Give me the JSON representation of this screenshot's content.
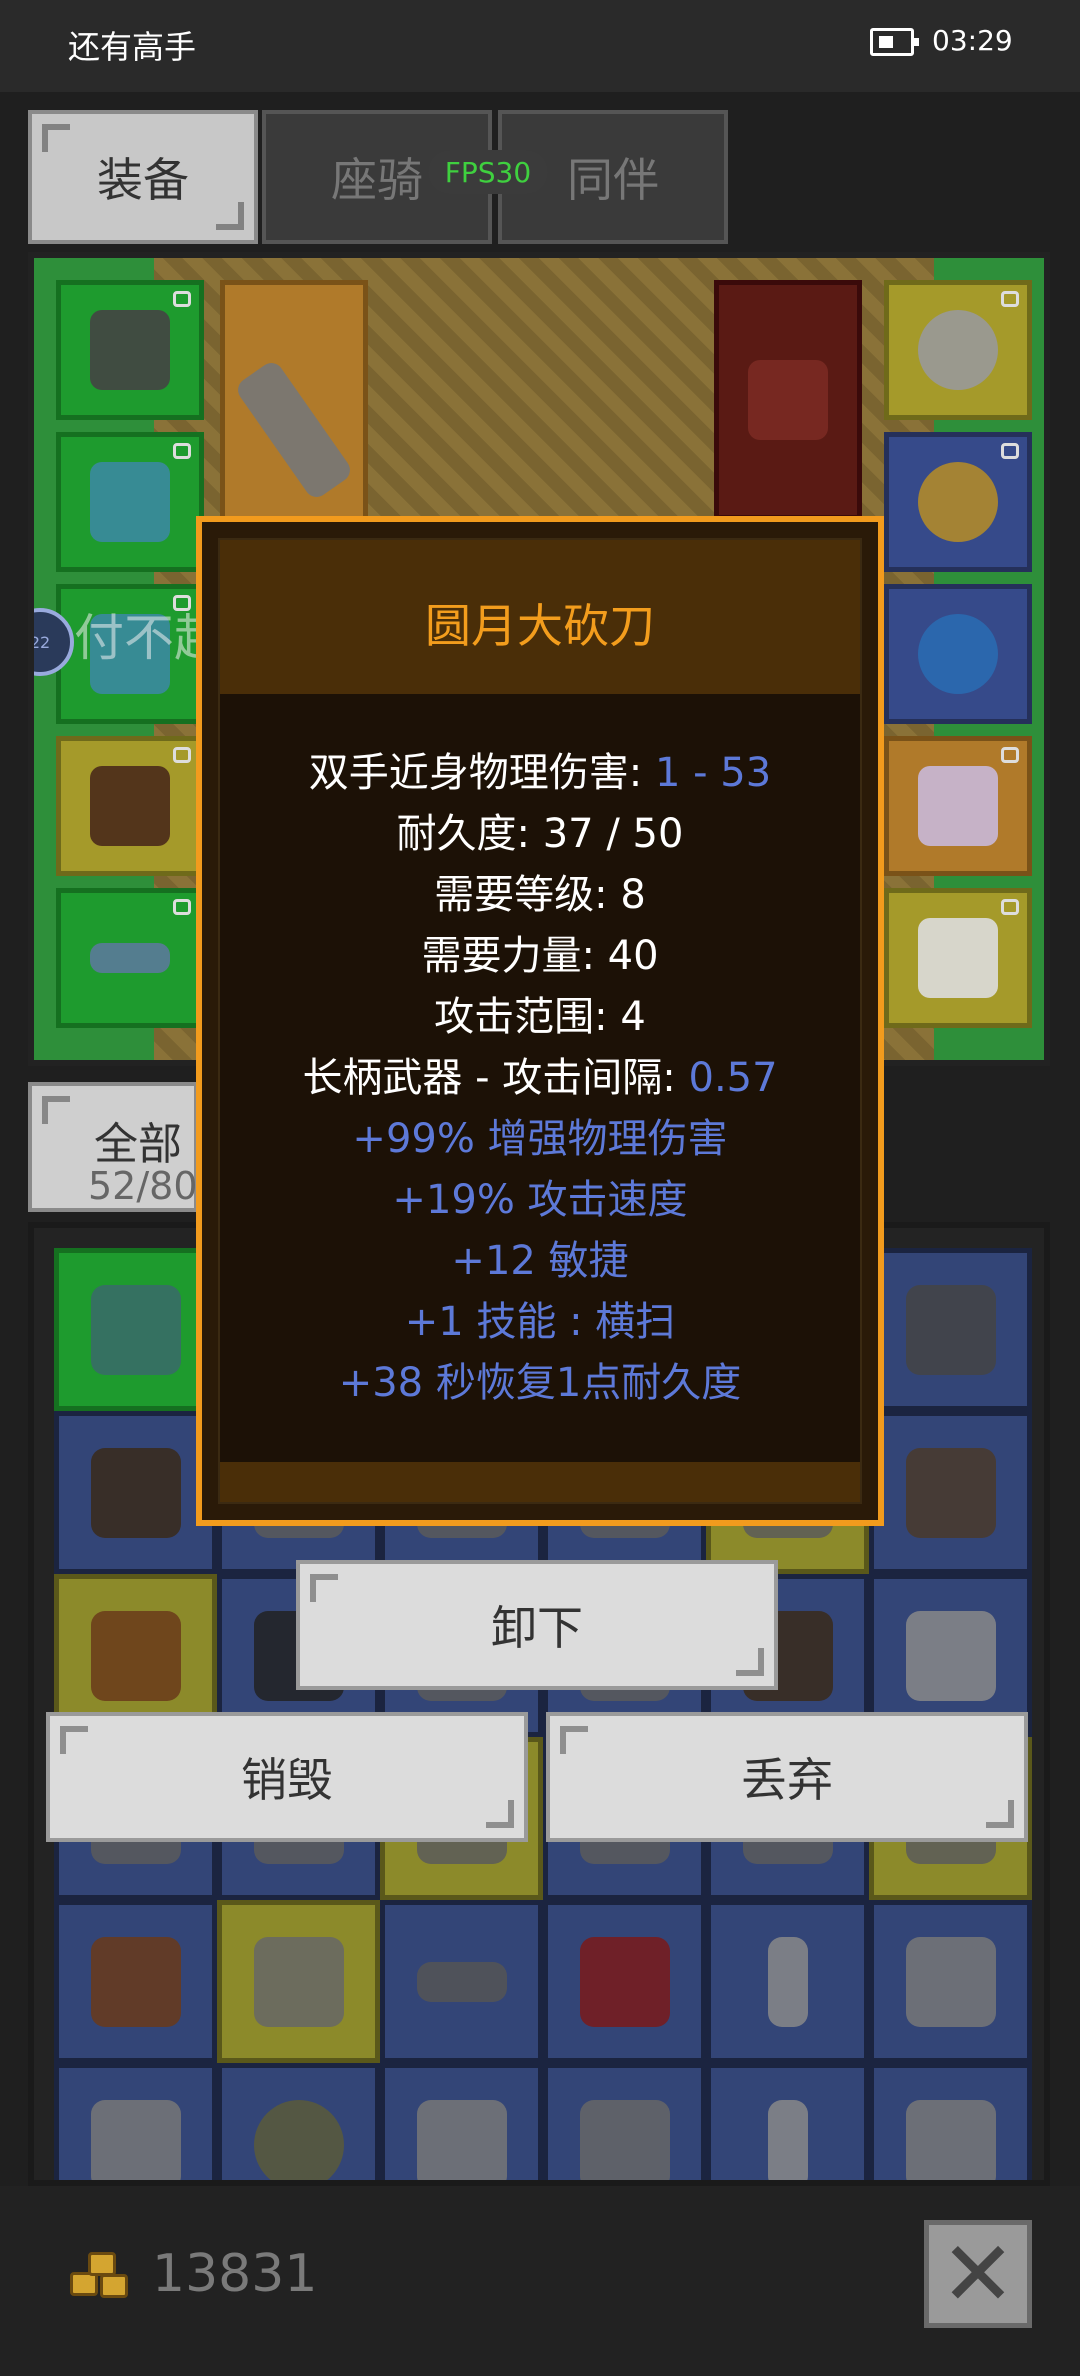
{
  "status_bar": {
    "title": "还有高手",
    "time": "03:29"
  },
  "tabs": [
    {
      "label": "装备",
      "active": true
    },
    {
      "label": "座骑",
      "active": false
    },
    {
      "label": "同伴",
      "active": false
    }
  ],
  "fps": "FPS30",
  "equip_panel": {
    "message": "付不起我的朋友～",
    "side_badge": "22"
  },
  "bag_tab": {
    "label": "全部",
    "count": "52/80"
  },
  "tooltip": {
    "title": "圆月大砍刀",
    "stats": [
      {
        "label": "双手近身物理伤害: ",
        "value": "1 - 53"
      },
      {
        "label": "耐久度: 37 / 50",
        "value": ""
      },
      {
        "label": "需要等级: 8",
        "value": ""
      },
      {
        "label": "需要力量: 40",
        "value": ""
      },
      {
        "label": "攻击范围: 4",
        "value": ""
      },
      {
        "label": "长柄武器 - 攻击间隔: ",
        "value": "0.57"
      }
    ],
    "bonuses": [
      "+99% 增强物理伤害",
      "+19% 攻击速度",
      "+12 敏捷",
      "+1 技能 : 横扫",
      "+38 秒恢复1点耐久度"
    ]
  },
  "actions": {
    "unequip": "卸下",
    "destroy": "销毁",
    "discard": "丢弃"
  },
  "footer": {
    "gold": "13831"
  },
  "colors": {
    "tooltip_border": "#f29b1d",
    "tooltip_title": "#f39d1d",
    "bonus_text": "#5d79d8",
    "fps": "#3fd03f"
  }
}
